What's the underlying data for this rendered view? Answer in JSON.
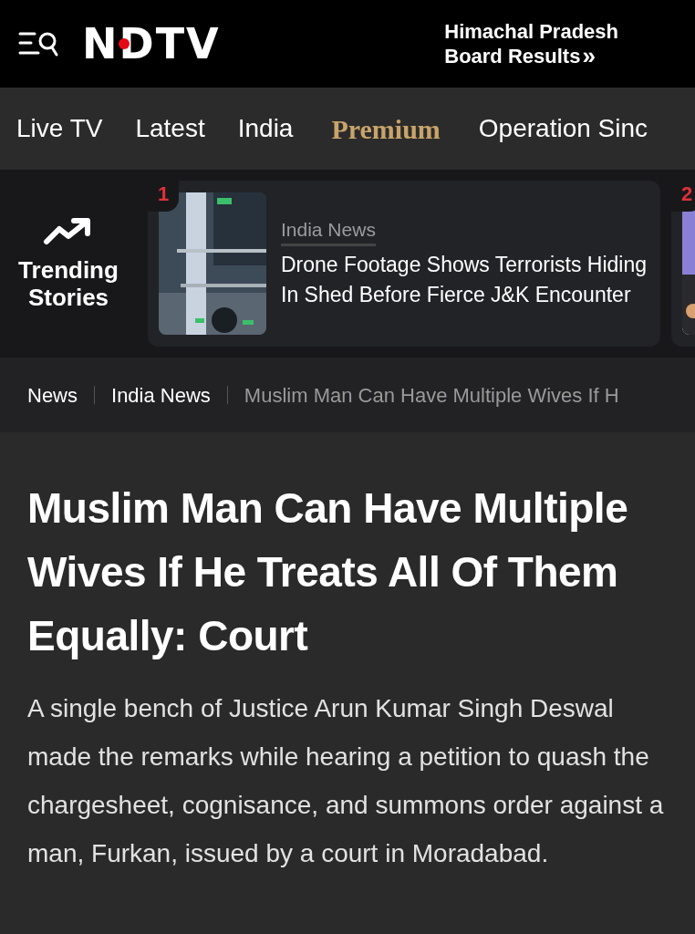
{
  "header": {
    "logo": "NDTV",
    "promo_line_1": "Himachal Pradesh",
    "promo_line_2": "Board Results",
    "promo_arrow": "»"
  },
  "nav": [
    {
      "label": "Live TV",
      "kind": "plain"
    },
    {
      "label": "Latest",
      "kind": "plain"
    },
    {
      "label": "India",
      "kind": "plain"
    },
    {
      "label": "Premium",
      "kind": "premium"
    },
    {
      "label": "Operation Sinc",
      "kind": "plain"
    }
  ],
  "trending": {
    "label_line_1": "Trending",
    "label_line_2": "Stories",
    "cards": [
      {
        "rank": "1",
        "category": "India News",
        "title": "Drone Footage Shows Terrorists Hiding In Shed Before Fierce J&K Encounter"
      },
      {
        "rank": "2"
      }
    ]
  },
  "breadcrumb": [
    {
      "label": "News",
      "kind": "link"
    },
    {
      "label": "India News",
      "kind": "link"
    },
    {
      "label": "Muslim Man Can Have Multiple Wives If H",
      "kind": "current"
    }
  ],
  "article": {
    "headline": "Muslim Man Can Have Multiple Wives If He Treats All Of Them Equally: Court",
    "summary": "A single bench of Justice Arun Kumar Singh Deswal made the remarks while hearing a petition to quash the chargesheet, cognisance, and summons order against a man, Furkan, issued by a court in Moradabad."
  }
}
